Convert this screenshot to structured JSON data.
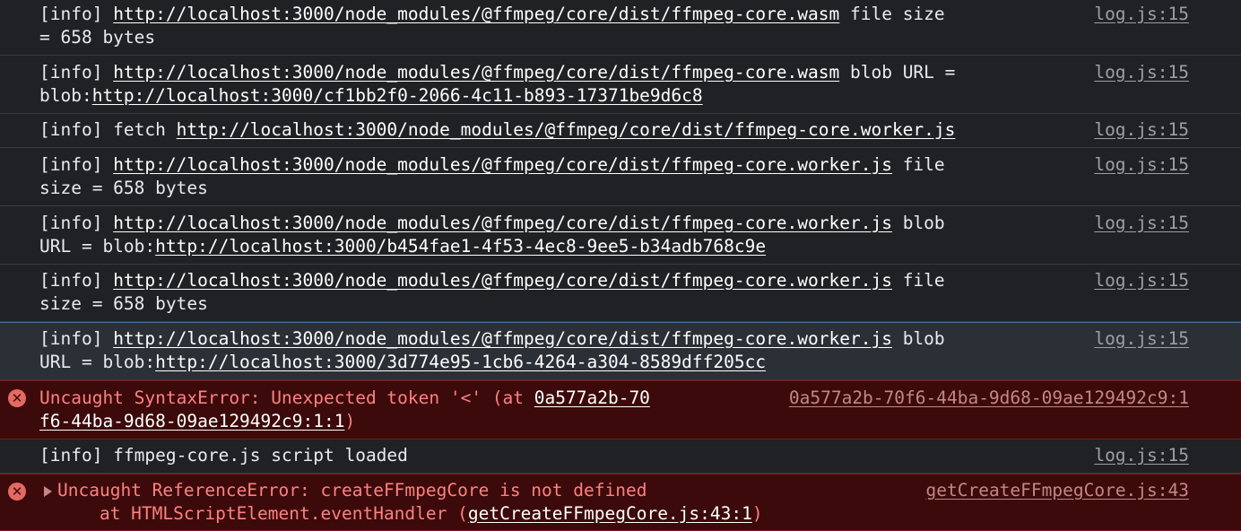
{
  "source_link": "log.js:15",
  "messages": [
    {
      "line1": {
        "pre": "[info] ",
        "link": "http://localhost:3000/node_modules/@ffmpeg/core/dist/ffmpeg-core.wasm",
        "post": " file size"
      },
      "line2": {
        "pre": "= 658 bytes"
      }
    },
    {
      "line1": {
        "pre": "[info] ",
        "link": "http://localhost:3000/node_modules/@ffmpeg/core/dist/ffmpeg-core.wasm",
        "post": " blob URL ="
      },
      "line2": {
        "pre": "blob:",
        "link": "http://localhost:3000/cf1bb2f0-2066-4c11-b893-17371be9d6c8"
      }
    },
    {
      "line1": {
        "pre": "[info] fetch ",
        "link": "http://localhost:3000/node_modules/@ffmpeg/core/dist/ffmpeg-core.worker.js"
      }
    },
    {
      "line1": {
        "pre": "[info] ",
        "link": "http://localhost:3000/node_modules/@ffmpeg/core/dist/ffmpeg-core.worker.js",
        "post": " file"
      },
      "line2": {
        "pre": "size = 658 bytes"
      }
    },
    {
      "line1": {
        "pre": "[info] ",
        "link": "http://localhost:3000/node_modules/@ffmpeg/core/dist/ffmpeg-core.worker.js",
        "post": " blob"
      },
      "line2": {
        "pre": "URL = blob:",
        "link": "http://localhost:3000/b454fae1-4f53-4ec8-9ee5-b34adb768c9e"
      }
    },
    {
      "line1": {
        "pre": "[info] ",
        "link": "http://localhost:3000/node_modules/@ffmpeg/core/dist/ffmpeg-core.worker.js",
        "post": " file"
      },
      "line2": {
        "pre": "size = 658 bytes"
      }
    },
    {
      "line1": {
        "pre": "[info] ",
        "link": "http://localhost:3000/node_modules/@ffmpeg/core/dist/ffmpeg-core.worker.js",
        "post": " blob"
      },
      "line2": {
        "pre": "URL = blob:",
        "link": "http://localhost:3000/3d774e95-1cb6-4264-a304-8589dff205cc"
      }
    }
  ],
  "error1": {
    "icon": "✕",
    "line1_pre": "Uncaught SyntaxError: Unexpected token '<' (at ",
    "line1_link": "0a577a2b-70",
    "line2_link": "f6-44ba-9d68-09ae129492c9:1:1",
    "line2_post": ")",
    "source": "0a577a2b-70f6-44ba-9d68-09ae129492c9:1"
  },
  "info_loaded": "[info] ffmpeg-core.js script loaded",
  "error2": {
    "icon": "✕",
    "line1": "Uncaught ReferenceError: createFFmpegCore is not defined",
    "line2_pre": "    at HTMLScriptElement.eventHandler (",
    "line2_link": "getCreateFFmpegCore.js:43:1",
    "line2_post": ")",
    "source": "getCreateFFmpegCore.js:43"
  }
}
